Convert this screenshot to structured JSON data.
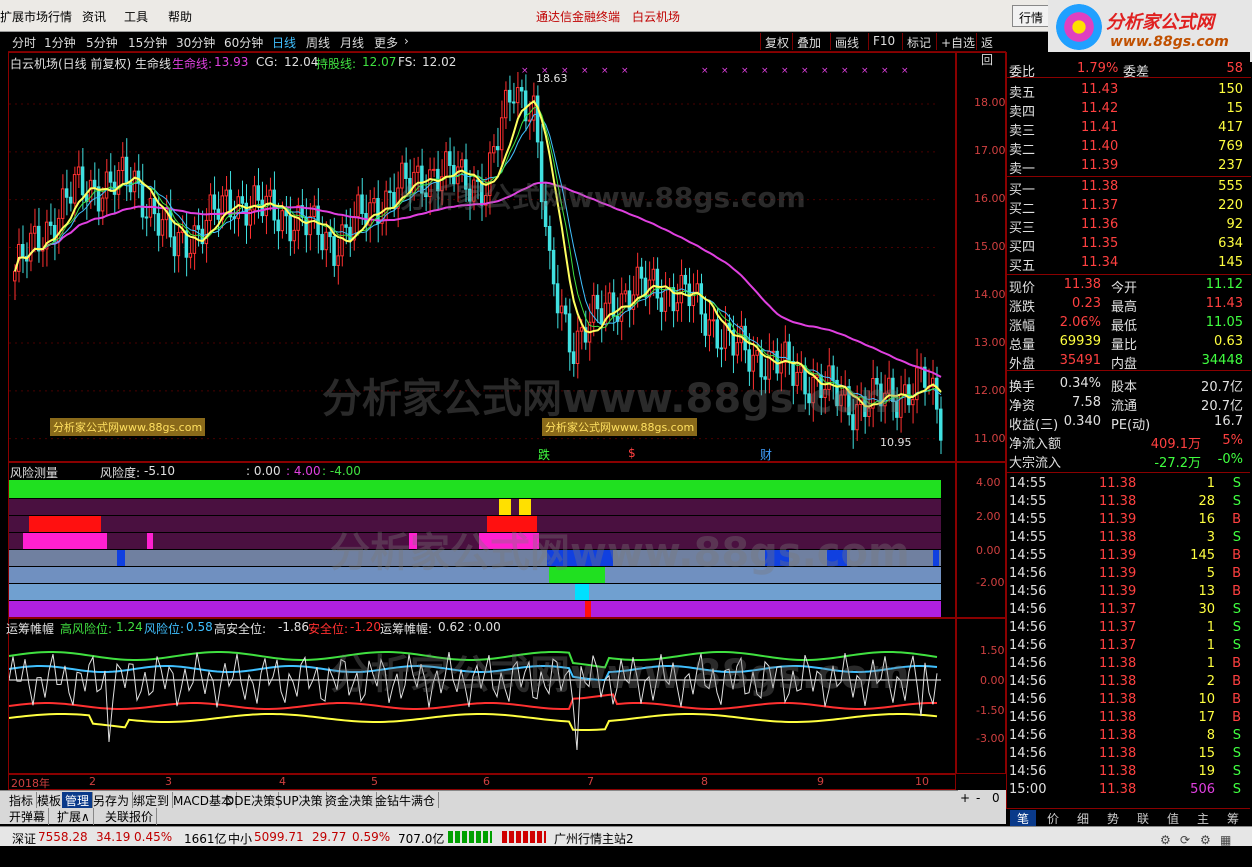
{
  "menu": {
    "items": [
      "扩展市场行情",
      "资讯",
      "工具",
      "帮助"
    ],
    "center_left": "通达信金融终端",
    "center_right": "白云机场",
    "right_button": "行情"
  },
  "logo": {
    "title": "分析家公式网",
    "url": "www.88gs.com"
  },
  "periods": {
    "items": [
      "分时",
      "1分钟",
      "5分钟",
      "15分钟",
      "30分钟",
      "60分钟",
      "日线",
      "周线",
      "月线",
      "更多"
    ],
    "active": "日线",
    "right_buttons": [
      "复权",
      "叠加",
      "画线",
      "F10",
      "标记",
      "+自选",
      "返回"
    ]
  },
  "main_chart": {
    "title": "白云机场(日线 前复权) 生命线",
    "indicators": [
      {
        "label": "生命线:",
        "value": "13.93",
        "color": "#e040e0"
      },
      {
        "label": "CG:",
        "value": "12.04",
        "color": "#e0e0e0"
      },
      {
        "label": "持股线:",
        "value": "12.07",
        "color": "#40e040"
      },
      {
        "label": "FS:",
        "value": "12.02",
        "color": "#e0e0e0"
      }
    ],
    "high_label": "18.63",
    "low_label": "10.95",
    "y_ticks": [
      "18.00",
      "17.00",
      "16.00",
      "15.00",
      "14.00",
      "13.00",
      "12.00",
      "11.00"
    ],
    "markers": [
      {
        "text": "跌",
        "color": "#40ff40"
      },
      {
        "text": "$",
        "color": "#ff4040"
      },
      {
        "text": "财",
        "color": "#40a0ff"
      }
    ],
    "watermark_text": "分析家公式网www.88gs.com",
    "tag_text": "分析家公式网www.88gs.com"
  },
  "risk_panel": {
    "title": "风险测量",
    "risk_label": "风险度:",
    "risk_value": "-5.10",
    "vals": [
      {
        "text": ": 0.00",
        "color": "#e0e0e0"
      },
      {
        "text": ": 4.00",
        "color": "#e040e0"
      },
      {
        "text": ": -4.00",
        "color": "#40e040"
      }
    ],
    "y_ticks": [
      "4.00",
      "2.00",
      "0.00",
      "-2.00"
    ]
  },
  "chip_panel": {
    "title": "运筹帷幄",
    "items": [
      {
        "label": "高风险位:",
        "value": "1.24",
        "color": "#40e040"
      },
      {
        "label": "风险位:",
        "value": "0.58",
        "color": "#40c0ff"
      },
      {
        "label": "高安全位:",
        "value": "-1.86",
        "color": "#e0e0e0"
      },
      {
        "label": "安全位:",
        "value": "-1.20",
        "color": "#ff3030"
      },
      {
        "label": "运筹帷幄:",
        "value": "0.62",
        "color": "#e0e0e0"
      },
      {
        "label": ":",
        "value": "0.00",
        "color": "#e0e0e0"
      }
    ],
    "y_ticks": [
      "1.50",
      "0.00",
      "-1.50",
      "-3.00"
    ]
  },
  "x_axis": [
    "2018年",
    "2",
    "3",
    "4",
    "5",
    "6",
    "7",
    "8",
    "9",
    "10"
  ],
  "quote": {
    "weibi_label": "委比",
    "weibi": "1.79%",
    "weicha_label": "委差",
    "weicha": "58",
    "asks": [
      {
        "label": "卖五",
        "price": "11.43",
        "vol": "150"
      },
      {
        "label": "卖四",
        "price": "11.42",
        "vol": "15"
      },
      {
        "label": "卖三",
        "price": "11.41",
        "vol": "417"
      },
      {
        "label": "卖二",
        "price": "11.40",
        "vol": "769"
      },
      {
        "label": "卖一",
        "price": "11.39",
        "vol": "237"
      }
    ],
    "bids": [
      {
        "label": "买一",
        "price": "11.38",
        "vol": "555"
      },
      {
        "label": "买二",
        "price": "11.37",
        "vol": "220"
      },
      {
        "label": "买三",
        "price": "11.36",
        "vol": "92"
      },
      {
        "label": "买四",
        "price": "11.35",
        "vol": "634"
      },
      {
        "label": "买五",
        "price": "11.34",
        "vol": "145"
      }
    ],
    "stats": [
      {
        "l1": "现价",
        "v1": "11.38",
        "c1": "#ff4040",
        "l2": "今开",
        "v2": "11.12",
        "c2": "#40ff40"
      },
      {
        "l1": "涨跌",
        "v1": "0.23",
        "c1": "#ff4040",
        "l2": "最高",
        "v2": "11.43",
        "c2": "#ff4040"
      },
      {
        "l1": "涨幅",
        "v1": "2.06%",
        "c1": "#ff4040",
        "l2": "最低",
        "v2": "11.05",
        "c2": "#40ff40"
      },
      {
        "l1": "总量",
        "v1": "69939",
        "c1": "#ffff40",
        "l2": "量比",
        "v2": "0.63",
        "c2": "#ffff40"
      },
      {
        "l1": "外盘",
        "v1": "35491",
        "c1": "#ff4040",
        "l2": "内盘",
        "v2": "34448",
        "c2": "#40ff40"
      },
      {
        "l1": "换手",
        "v1": "0.34%",
        "c1": "#e0e0e0",
        "l2": "股本",
        "v2": "20.7亿",
        "c2": "#e0e0e0"
      },
      {
        "l1": "净资",
        "v1": "7.58",
        "c1": "#e0e0e0",
        "l2": "流通",
        "v2": "20.7亿",
        "c2": "#e0e0e0"
      },
      {
        "l1": "收益(三)",
        "v1": "0.340",
        "c1": "#e0e0e0",
        "l2": "PE(动)",
        "v2": "16.7",
        "c2": "#e0e0e0"
      }
    ],
    "inflow_label": "净流入额",
    "inflow": "409.1万",
    "inflow_pct": "5%",
    "block_label": "大宗流入",
    "block": "-27.2万",
    "block_pct": "-0%"
  },
  "ticks": [
    {
      "t": "14:55",
      "p": "11.38",
      "v": "1",
      "s": "S"
    },
    {
      "t": "14:55",
      "p": "11.38",
      "v": "28",
      "s": "S"
    },
    {
      "t": "14:55",
      "p": "11.39",
      "v": "16",
      "s": "B"
    },
    {
      "t": "14:55",
      "p": "11.38",
      "v": "3",
      "s": "S"
    },
    {
      "t": "14:55",
      "p": "11.39",
      "v": "145",
      "s": "B"
    },
    {
      "t": "14:56",
      "p": "11.39",
      "v": "5",
      "s": "B"
    },
    {
      "t": "14:56",
      "p": "11.39",
      "v": "13",
      "s": "B"
    },
    {
      "t": "14:56",
      "p": "11.37",
      "v": "30",
      "s": "S"
    },
    {
      "t": "14:56",
      "p": "11.37",
      "v": "1",
      "s": "S"
    },
    {
      "t": "14:56",
      "p": "11.37",
      "v": "1",
      "s": "S"
    },
    {
      "t": "14:56",
      "p": "11.38",
      "v": "1",
      "s": "B"
    },
    {
      "t": "14:56",
      "p": "11.38",
      "v": "2",
      "s": "B"
    },
    {
      "t": "14:56",
      "p": "11.38",
      "v": "10",
      "s": "B"
    },
    {
      "t": "14:56",
      "p": "11.38",
      "v": "17",
      "s": "B"
    },
    {
      "t": "14:56",
      "p": "11.38",
      "v": "8",
      "s": "S"
    },
    {
      "t": "14:56",
      "p": "11.38",
      "v": "15",
      "s": "S"
    },
    {
      "t": "14:56",
      "p": "11.38",
      "v": "19",
      "s": "S"
    },
    {
      "t": "15:00",
      "p": "11.38",
      "v": "506",
      "s": "S"
    }
  ],
  "bottom_tabs": [
    "指标",
    "模板",
    "管理",
    "另存为",
    "绑定到",
    "MACD基本",
    "DDE决策",
    "SUP决策",
    "资金决策",
    "金钻牛满仓"
  ],
  "bottom_tabs_active": "管理",
  "bottom_tabs2": [
    "开弹幕",
    "扩展∧",
    "关联报价"
  ],
  "scroll_btns": [
    "+",
    "-",
    "0"
  ],
  "right_tabs": [
    "笔",
    "价",
    "细",
    "势",
    "联",
    "值",
    "主",
    "筹"
  ],
  "status": {
    "sz_label": "深证",
    "sz_val": "7558.28",
    "sz_chg": "34.19",
    "sz_pct": "0.45%",
    "sz_amt": "1661亿",
    "zx_label": "中小",
    "zx_val": "5099.71",
    "zx_chg": "29.77",
    "zx_pct": "0.59%",
    "zx_amt": "707.0亿",
    "server": "广州行情主站2"
  },
  "chart_data": {
    "type": "candlestick",
    "x_labels": [
      "2018年",
      "2",
      "3",
      "4",
      "5",
      "6",
      "7",
      "8",
      "9",
      "10"
    ],
    "ylim": [
      10.7,
      18.9
    ],
    "high": 18.63,
    "low": 10.95,
    "series": [
      {
        "name": "生命线",
        "last": 13.93
      },
      {
        "name": "CG",
        "last": 12.04
      },
      {
        "name": "持股线",
        "last": 12.07
      },
      {
        "name": "FS",
        "last": 12.02
      }
    ]
  }
}
